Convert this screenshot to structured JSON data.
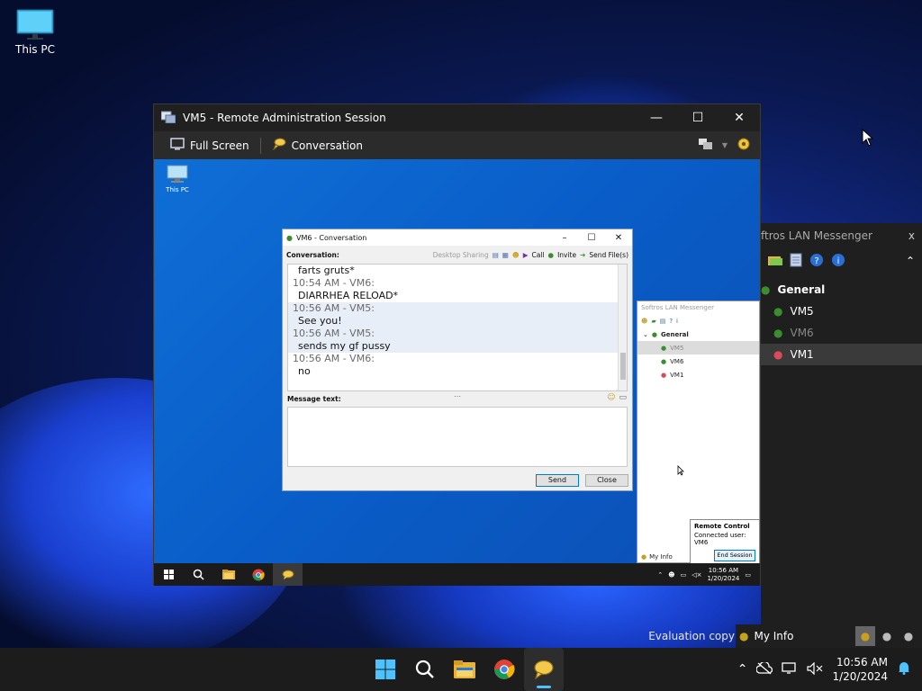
{
  "desktop": {
    "icon_label": "This PC",
    "watermark": "Evaluation copy"
  },
  "remote_window": {
    "title": "VM5 - Remote Administration Session",
    "controls": {
      "minimize": "—",
      "maximize": "☐",
      "close": "✕"
    },
    "toolbar": {
      "full_screen": "Full Screen",
      "conversation": "Conversation"
    }
  },
  "remote_desktop": {
    "icon_label": "This PC"
  },
  "conversation": {
    "title": "VM6 - Conversation",
    "label": "Conversation:",
    "actions": {
      "desktop_sharing": "Desktop Sharing",
      "call": "Call",
      "invite": "Invite",
      "send_files": "Send File(s)"
    },
    "messages": [
      {
        "type": "body",
        "text": "farts gruts*",
        "hl": false
      },
      {
        "type": "head",
        "text": "10:54 AM - VM6:",
        "hl": false
      },
      {
        "type": "body",
        "text": "DIARRHEA RELOAD*",
        "hl": false
      },
      {
        "type": "head",
        "text": "10:56 AM - VM5:",
        "hl": true
      },
      {
        "type": "body",
        "text": "See you!",
        "hl": true
      },
      {
        "type": "head",
        "text": "10:56 AM - VM5:",
        "hl": true
      },
      {
        "type": "body",
        "text": "sends my gf pussy",
        "hl": true
      },
      {
        "type": "head",
        "text": "10:56 AM - VM6:",
        "hl": false
      },
      {
        "type": "body",
        "text": "no",
        "hl": false
      }
    ],
    "message_label": "Message text:",
    "message_value": "",
    "send": "Send",
    "close": "Close"
  },
  "remote_messenger": {
    "title": "Softros LAN Messenger",
    "group": "General",
    "users": [
      "VM5",
      "VM6",
      "VM1"
    ],
    "my_info": "My Info"
  },
  "remote_control_popup": {
    "heading": "Remote Control",
    "connected": "Connected user: VM6",
    "end_session": "End Session"
  },
  "remote_taskbar": {
    "time": "10:56 AM",
    "date": "1/20/2024"
  },
  "host_messenger": {
    "title": "ftros LAN Messenger",
    "close": "x",
    "group": "General",
    "users": [
      "VM5",
      "VM6",
      "VM1"
    ],
    "my_info": "My Info"
  },
  "taskbar": {
    "time": "10:56 AM",
    "date": "1/20/2024"
  },
  "colors": {
    "accent": "#0078d7",
    "taskbar_indicator": "#4cc2ff",
    "user_green": "#3c8d2f",
    "user_red": "#d94a5a"
  }
}
